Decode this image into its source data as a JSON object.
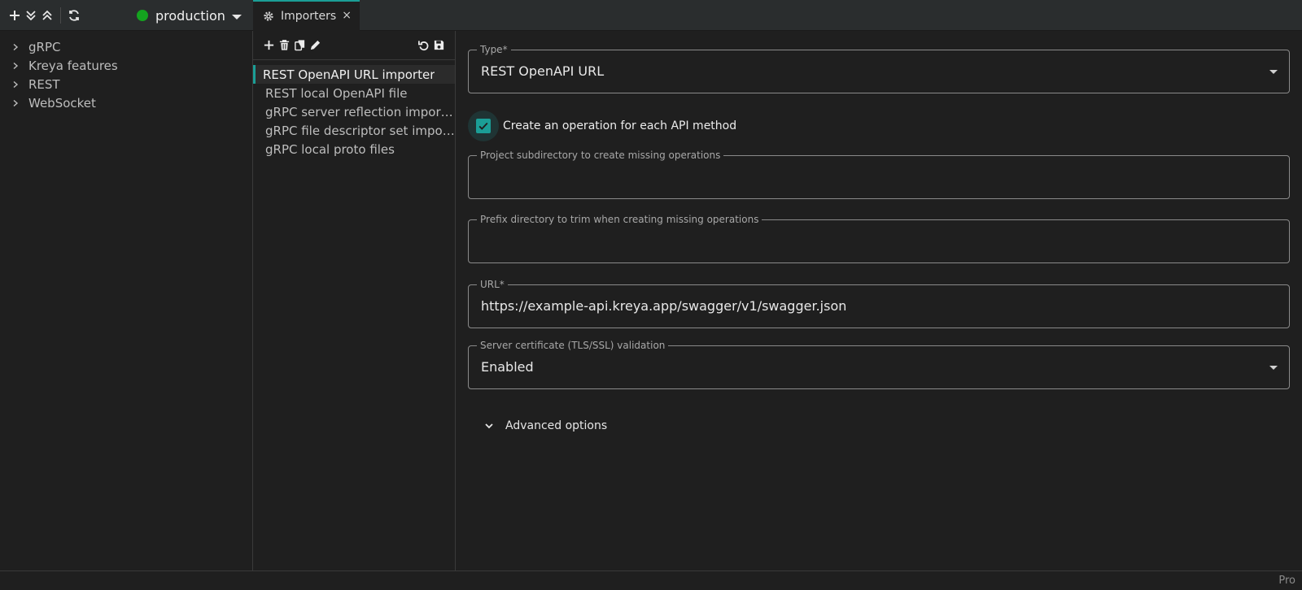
{
  "toolbar": {
    "icons": [
      "plus-icon",
      "expand-all-icon",
      "collapse-all-icon",
      "refresh-icon"
    ]
  },
  "environment": {
    "label": "production",
    "status_color": "#14a31f"
  },
  "tab": {
    "label": "Importers",
    "close": "×"
  },
  "tree": {
    "items": [
      {
        "label": "gRPC"
      },
      {
        "label": "Kreya features"
      },
      {
        "label": "REST"
      },
      {
        "label": "WebSocket"
      }
    ]
  },
  "importers": {
    "items": [
      {
        "label": "REST OpenAPI URL importer",
        "active": true
      },
      {
        "label": "REST local OpenAPI file"
      },
      {
        "label": "gRPC server reflection importer"
      },
      {
        "label": "gRPC file descriptor set importer"
      },
      {
        "label": "gRPC local proto files"
      }
    ]
  },
  "form": {
    "type": {
      "legend": "Type*",
      "value": "REST OpenAPI URL"
    },
    "create_ops": {
      "label": "Create an operation for each API method",
      "checked": true
    },
    "subdir": {
      "legend": "Project subdirectory to create missing operations",
      "value": ""
    },
    "prefix": {
      "legend": "Prefix directory to trim when creating missing operations",
      "value": ""
    },
    "url": {
      "legend": "URL*",
      "value": "https://example-api.kreya.app/swagger/v1/swagger.json"
    },
    "tls": {
      "legend": "Server certificate (TLS/SSL) validation",
      "value": "Enabled"
    },
    "advanced": {
      "label": "Advanced options"
    }
  },
  "status": {
    "plan": "Pro"
  },
  "colors": {
    "accent": "#1b9e96",
    "background": "#1f1f1f"
  }
}
